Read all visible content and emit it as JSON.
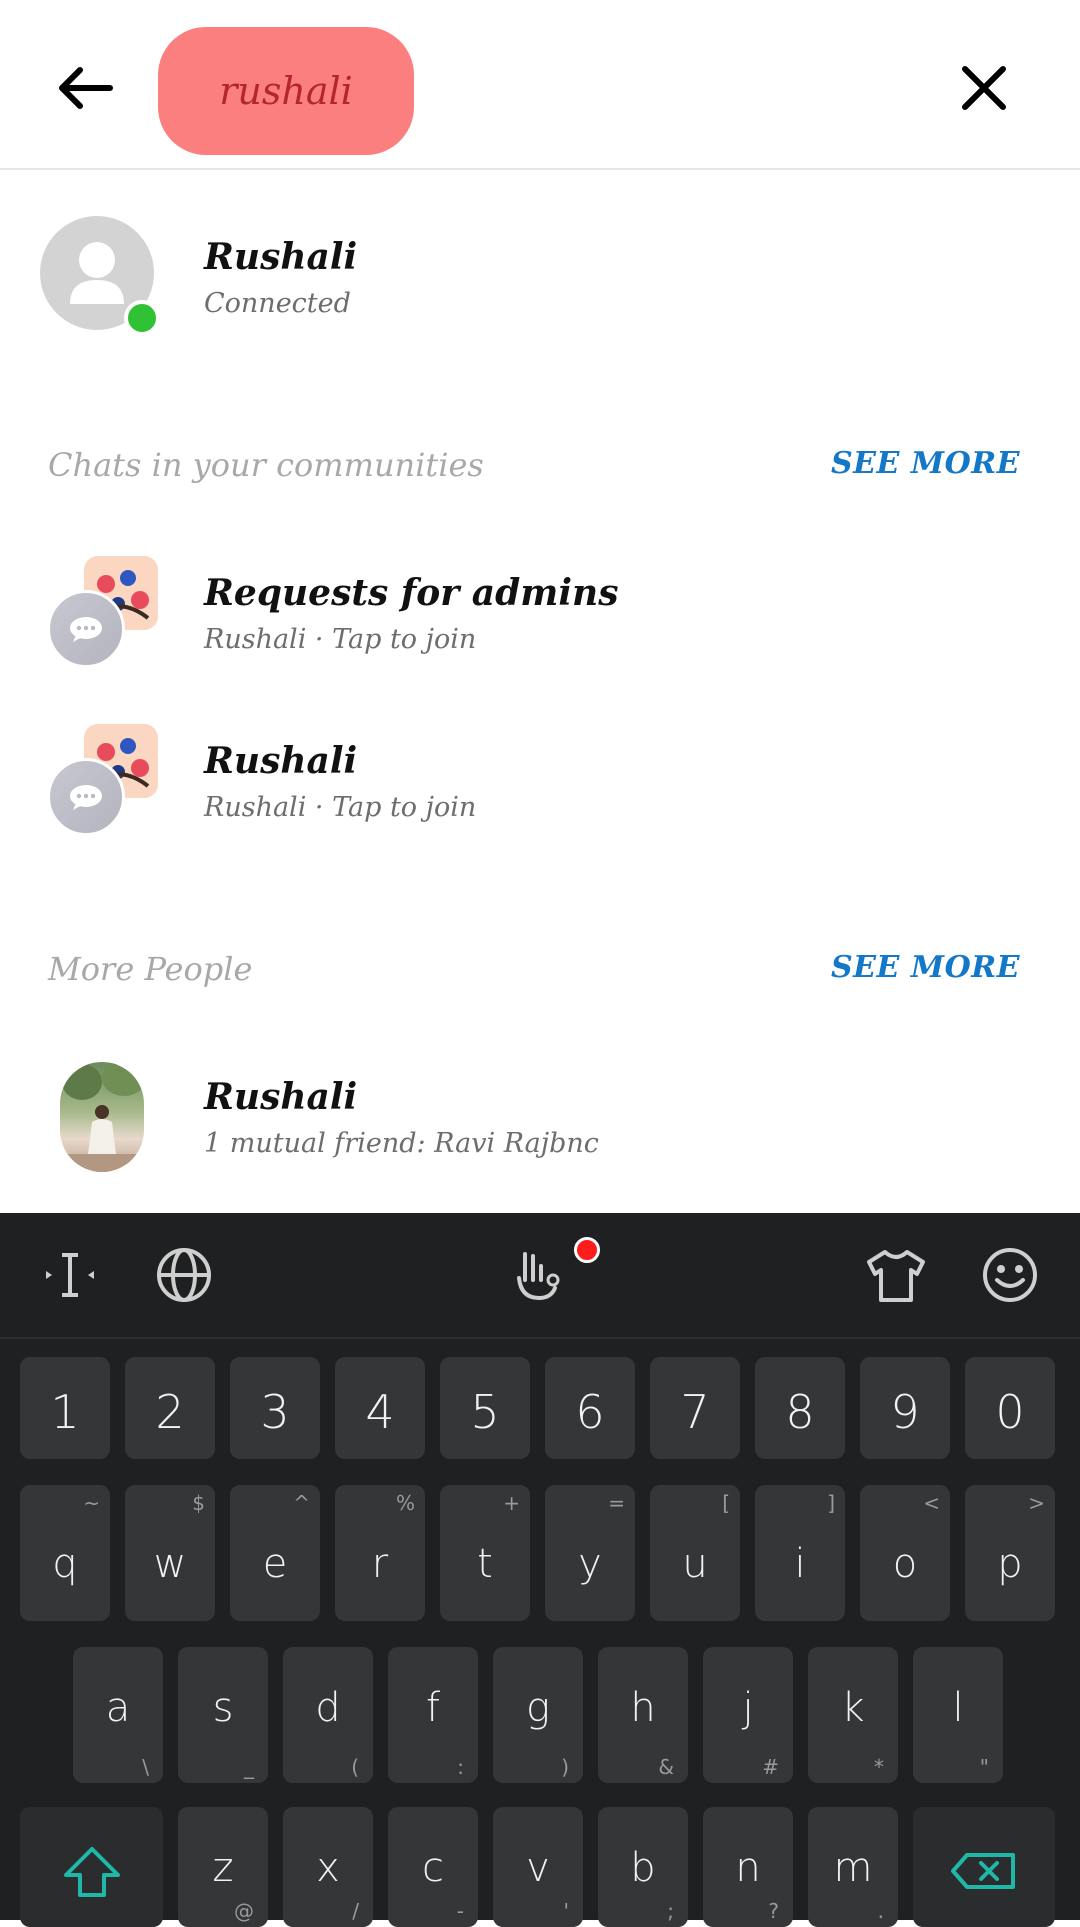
{
  "search": {
    "query": "rushali"
  },
  "top_result": {
    "name": "Rushali",
    "status": "Connected"
  },
  "communities": {
    "heading": "Chats in your communities",
    "see_more": "SEE MORE",
    "items": [
      {
        "title": "Requests for admins",
        "subtitle": "Rushali · Tap to join"
      },
      {
        "title": "Rushali",
        "subtitle": "Rushali · Tap to join"
      }
    ]
  },
  "more_people": {
    "heading": "More People",
    "see_more": "SEE MORE",
    "items": [
      {
        "name": "Rushali",
        "subtitle": "1 mutual friend: Ravi Rajbnc"
      }
    ]
  },
  "keyboard": {
    "numbers": [
      "1",
      "2",
      "3",
      "4",
      "5",
      "6",
      "7",
      "8",
      "9",
      "0"
    ],
    "row1": [
      {
        "key": "q",
        "hint": "~"
      },
      {
        "key": "w",
        "hint": "$"
      },
      {
        "key": "e",
        "hint": "^"
      },
      {
        "key": "r",
        "hint": "%"
      },
      {
        "key": "t",
        "hint": "+"
      },
      {
        "key": "y",
        "hint": "="
      },
      {
        "key": "u",
        "hint": "["
      },
      {
        "key": "i",
        "hint": "]"
      },
      {
        "key": "o",
        "hint": "<"
      },
      {
        "key": "p",
        "hint": ">"
      }
    ],
    "row2": [
      {
        "key": "a",
        "hint": "\\"
      },
      {
        "key": "s",
        "hint": "_"
      },
      {
        "key": "d",
        "hint": "("
      },
      {
        "key": "f",
        "hint": ":"
      },
      {
        "key": "g",
        "hint": ")"
      },
      {
        "key": "h",
        "hint": "&"
      },
      {
        "key": "j",
        "hint": "#"
      },
      {
        "key": "k",
        "hint": "*"
      },
      {
        "key": "l",
        "hint": "\""
      }
    ],
    "row3": [
      {
        "key": "z",
        "hint": "@"
      },
      {
        "key": "x",
        "hint": "/"
      },
      {
        "key": "c",
        "hint": "-"
      },
      {
        "key": "v",
        "hint": "'"
      },
      {
        "key": "b",
        "hint": ";"
      },
      {
        "key": "n",
        "hint": "?"
      },
      {
        "key": "m",
        "hint": "."
      }
    ],
    "accent_color": "#1fb8a8"
  }
}
